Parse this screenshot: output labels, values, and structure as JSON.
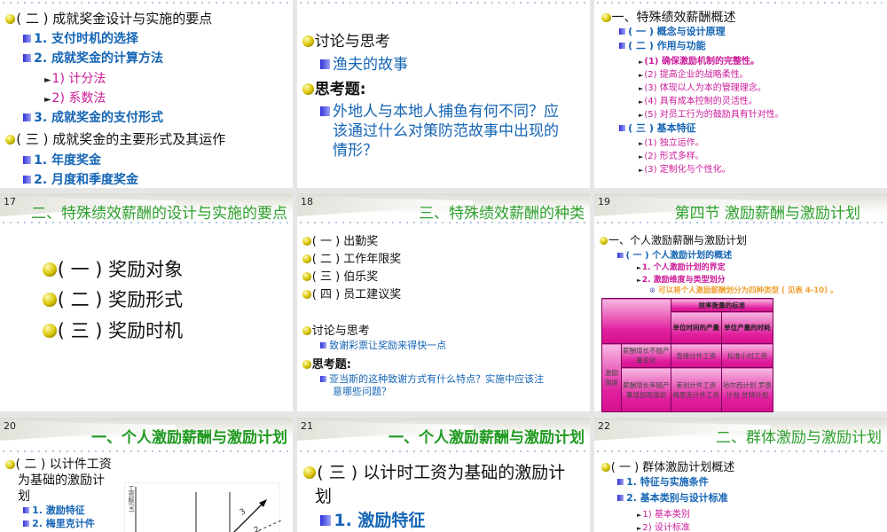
{
  "slides": {
    "s16": {
      "lines": [
        "( 二 ) 成就奖金设计与实施的要点",
        "1.  支付时机的选择",
        "2.  成就奖金的计算方法",
        "1)    计分法",
        "2)    系数法",
        "3.  成就奖金的支付形式",
        "( 三 ) 成就奖金的主要形式及其运作",
        "1.  年度奖金",
        "2.  月度和季度奖金"
      ]
    },
    "s16b": {
      "lines": [
        "讨论与思考",
        "渔夫的故事",
        "思考题:",
        "外地人与本地人捕鱼有何不同？应",
        "该通过什么对策防范故事中出现的",
        "情形？"
      ]
    },
    "s16c": {
      "lines": [
        "一、特殊绩效薪酬概述",
        "( 一 ) 概念与设计原理",
        "( 二 ) 作用与功能",
        "(1)       确保激励机制的完整性。",
        "(2)       提高企业的战略柔性。",
        "(3)       体现以人为本的管理理念。",
        "(4)       具有成本控制的灵活性。",
        "(5)       对员工行为的鼓励具有针对性。",
        "( 三 ) 基本特征",
        "(1)       独立运作。",
        "(2)       形式多样。",
        "(3)       定制化与个性化。"
      ]
    },
    "s17": {
      "number": "17",
      "title": "二、特殊绩效薪酬的设计与实施的要点",
      "lines": [
        "( 一 ) 奖励对象",
        "( 二 ) 奖励形式",
        "( 三 ) 奖励时机"
      ]
    },
    "s18": {
      "number": "18",
      "title": "三、特殊绩效薪酬的种类",
      "lines": [
        "( 一 ) 出勤奖",
        "( 二 ) 工作年限奖",
        "( 三 ) 伯乐奖",
        "( 四 ) 员工建议奖",
        "讨论与思考",
        "致谢彩票让奖励来得快一点",
        "思考题:",
        "亚当斯的这种致谢方式有什么特点？实施中应该注",
        "意哪些问题？"
      ]
    },
    "s19": {
      "number": "19",
      "title": "第四节    激励薪酬与激励计划",
      "lines": [
        "一、个人激励薪酬与激励计划",
        "( 一 ) 个人激励计划的概述",
        "1.  个人激励计划的界定",
        "2.  激励维度与类型划分",
        "可以将个人激励薪酬划分为四种类型 ( 见表 4-10) 。"
      ],
      "table": {
        "col_group": "效率衡量的标准",
        "cols": [
          "单位时间的产量",
          "单位产量的时耗"
        ],
        "row_group": "激励强度",
        "rows": [
          {
            "label": "薪酬增长不随产量变化",
            "cells": [
              "直接计件工资",
              "标准小时工资"
            ]
          },
          {
            "label": "薪酬增长率随产量增加而增加",
            "cells": [
              "差别计件工资 梅里克计件工资",
              "哈尔西计划 罗恩计划 甘特计划"
            ]
          }
        ]
      }
    },
    "s20": {
      "number": "20",
      "title": "一、个人激励薪酬与激励计划",
      "lines": [
        "( 二 ) 以计件工资",
        "为基础的激励计",
        "划",
        "1.  激励特征",
        "2.  梅里克计件"
      ],
      "chart": {
        "ylabel": "工资额(¥)",
        "labels": [
          "3",
          "2"
        ]
      }
    },
    "s21": {
      "number": "21",
      "title": "一、个人激励薪酬与激励计划",
      "lines": [
        "( 三 ) 以计时工资为基础的激励计",
        "划",
        "1.  激励特征"
      ]
    },
    "s22": {
      "number": "22",
      "title": "二、群体激励与激励计划",
      "lines": [
        "( 一 ) 群体激励计划概述",
        "1.  特征与实施条件",
        "2.  基本类别与设计标准",
        "1)       基本类别",
        "2)       设计标准"
      ]
    }
  },
  "colors": {
    "title_green": "#2ea02e",
    "blue_text": "#1565b5",
    "pink_text": "#cc1a99",
    "table_magenta": "#e0209e"
  }
}
